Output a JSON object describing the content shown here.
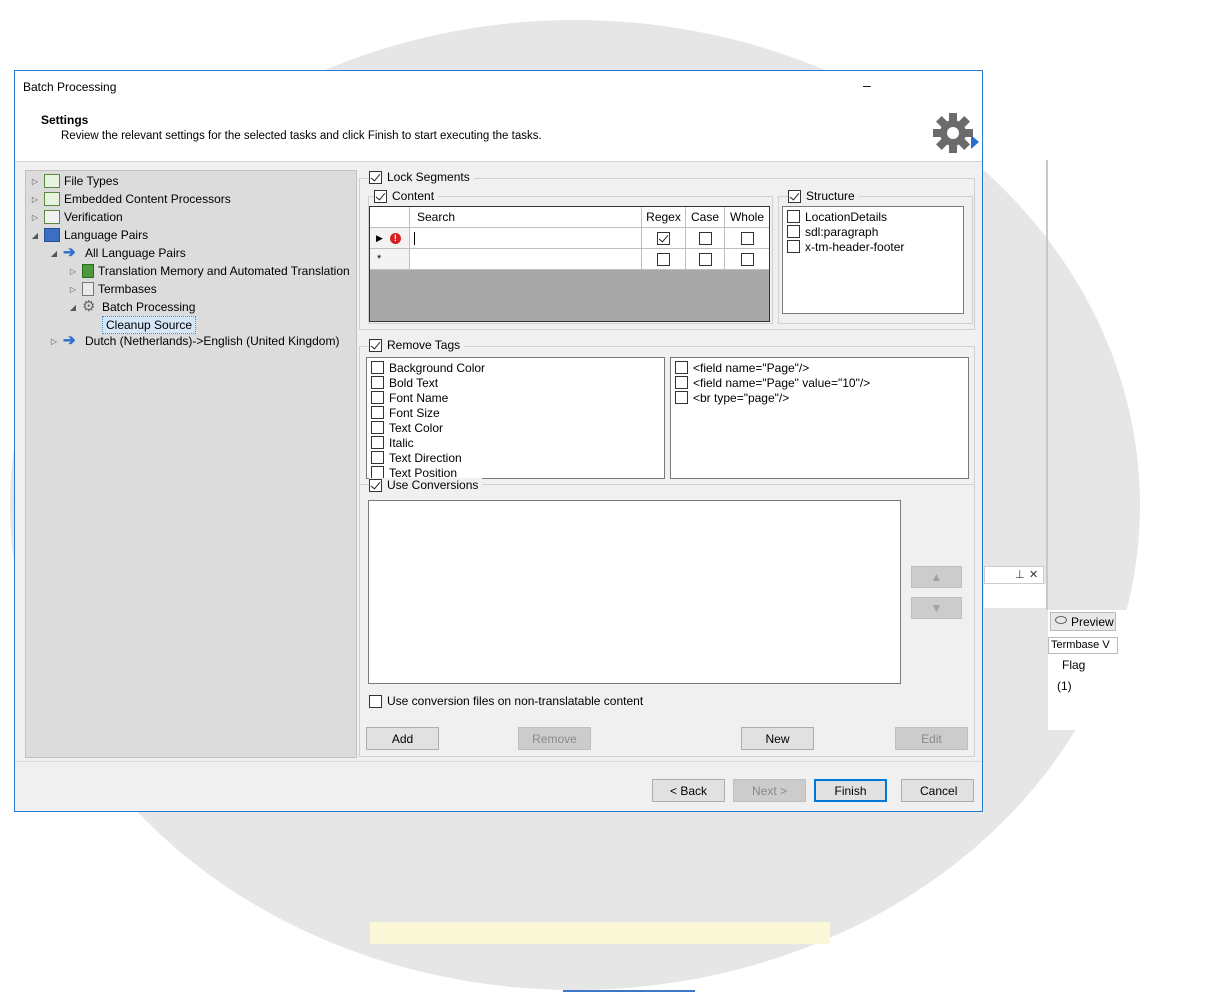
{
  "dialog": {
    "title": "Batch Processing",
    "header_title": "Settings",
    "header_subtitle": "Review the relevant settings for the selected tasks and click Finish to start executing the tasks.",
    "minimize_glyph": "–"
  },
  "tree": {
    "file_types": "File Types",
    "embedded": "Embedded Content Processors",
    "verification": "Verification",
    "language_pairs": "Language Pairs",
    "all_language_pairs": "All Language Pairs",
    "tm": "Translation Memory and Automated Translation",
    "termbases": "Termbases",
    "batch_processing": "Batch Processing",
    "cleanup_source": "Cleanup Source",
    "dutch": "Dutch (Netherlands)->English (United Kingdom)"
  },
  "lock_segments": {
    "label": "Lock Segments",
    "checked": true,
    "content_label": "Content",
    "structure_label": "Structure",
    "grid": {
      "headers": [
        "Search",
        "Regex",
        "Case",
        "Whole"
      ],
      "new_row_marker": "*"
    },
    "structure_items": [
      "LocationDetails",
      "sdl:paragraph",
      "x-tm-header-footer"
    ]
  },
  "remove_tags": {
    "label": "Remove Tags",
    "left_items": [
      "Background Color",
      "Bold Text",
      "Font Name",
      "Font Size",
      "Text Color",
      "Italic",
      "Text Direction",
      "Text Position"
    ],
    "right_items": [
      "<field name=\"Page\"/>",
      "<field name=\"Page\" value=\"10\"/>",
      "<br type=\"page\"/>"
    ]
  },
  "conversions": {
    "label": "Use Conversions",
    "nontranslatable_label": "Use conversion files on non-translatable content",
    "up_glyph": "▲",
    "down_glyph": "▼",
    "buttons": {
      "add": "Add",
      "remove": "Remove",
      "new": "New",
      "edit": "Edit"
    }
  },
  "footer": {
    "back": "< Back",
    "next": "Next >",
    "finish": "Finish",
    "cancel": "Cancel"
  },
  "background": {
    "preview_tab": "Preview",
    "termbase": "Termbase V",
    "flag": "Flag",
    "one": "(1)",
    "pin_glyph": "⊥",
    "close_glyph": "✕"
  }
}
